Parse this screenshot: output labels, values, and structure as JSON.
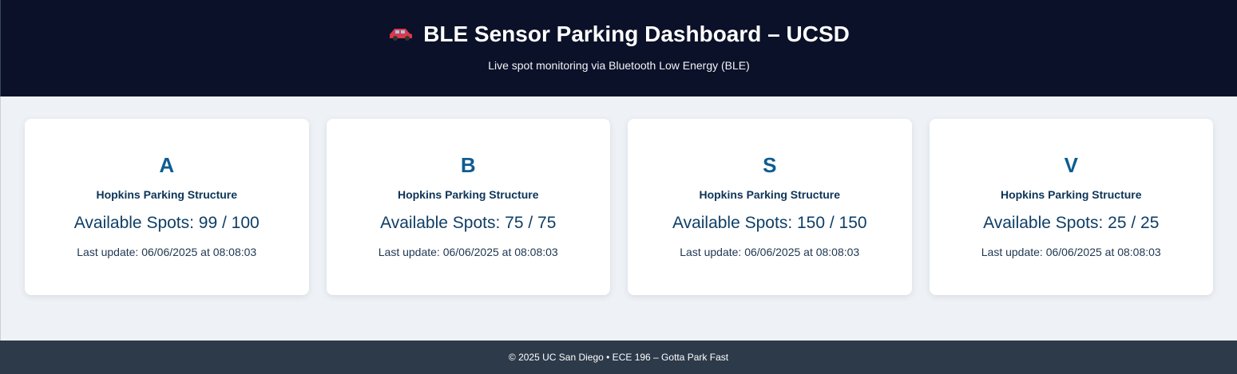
{
  "header": {
    "icon": "car-icon",
    "title": "BLE Sensor Parking Dashboard – UCSD",
    "subtitle": "Live spot monitoring via Bluetooth Low Energy (BLE)"
  },
  "cards": [
    {
      "letter": "A",
      "structure": "Hopkins Parking Structure",
      "spots": "Available Spots: 99 / 100",
      "update": "Last update: 06/06/2025 at 08:08:03"
    },
    {
      "letter": "B",
      "structure": "Hopkins Parking Structure",
      "spots": "Available Spots: 75 / 75",
      "update": "Last update: 06/06/2025 at 08:08:03"
    },
    {
      "letter": "S",
      "structure": "Hopkins Parking Structure",
      "spots": "Available Spots: 150 / 150",
      "update": "Last update: 06/06/2025 at 08:08:03"
    },
    {
      "letter": "V",
      "structure": "Hopkins Parking Structure",
      "spots": "Available Spots: 25 / 25",
      "update": "Last update: 06/06/2025 at 08:08:03"
    }
  ],
  "footer": {
    "text": "© 2025 UC San Diego • ECE 196 – Gotta Park Fast"
  },
  "colors": {
    "header_bg": "#0b1128",
    "page_bg": "#eef2f6",
    "accent": "#0e5c91",
    "footer_bg": "#2c3a4a",
    "car": "#d9394b"
  }
}
